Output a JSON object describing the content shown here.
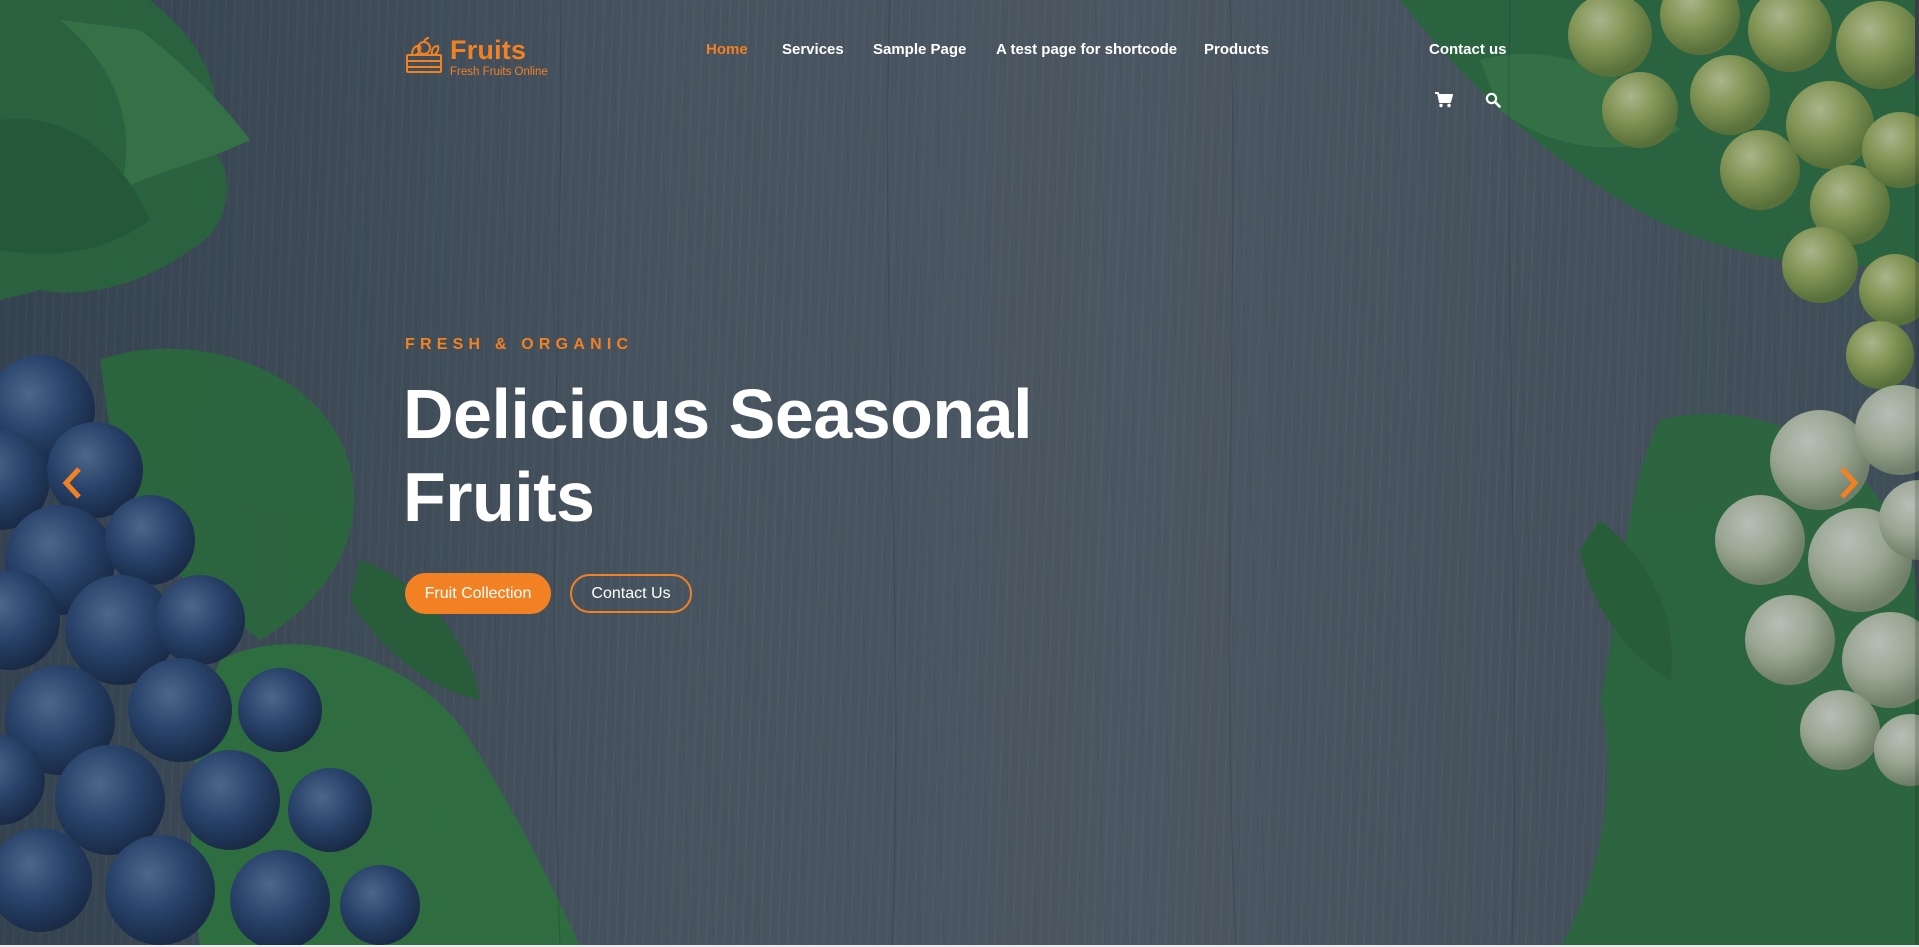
{
  "brand": {
    "name": "Fruits",
    "tagline": "Fresh Fruits Online",
    "logo_icon": "fruit-crate-icon",
    "accent_color": "#f28123"
  },
  "nav": {
    "items": [
      {
        "label": "Home",
        "active": true
      },
      {
        "label": "Services",
        "active": false
      },
      {
        "label": "Sample Page",
        "active": false
      },
      {
        "label": "A test page for shortcode",
        "active": false
      },
      {
        "label": "Products",
        "active": false
      }
    ],
    "contact": "Contact us",
    "cart_icon": "shopping-cart-icon",
    "search_icon": "search-icon"
  },
  "hero": {
    "subtitle": "FRESH & ORGANIC",
    "headline_line1": "Delicious Seasonal",
    "headline_line2": "Fruits",
    "primary_button": "Fruit Collection",
    "secondary_button": "Contact Us",
    "prev_icon": "chevron-left-icon",
    "next_icon": "chevron-right-icon"
  }
}
